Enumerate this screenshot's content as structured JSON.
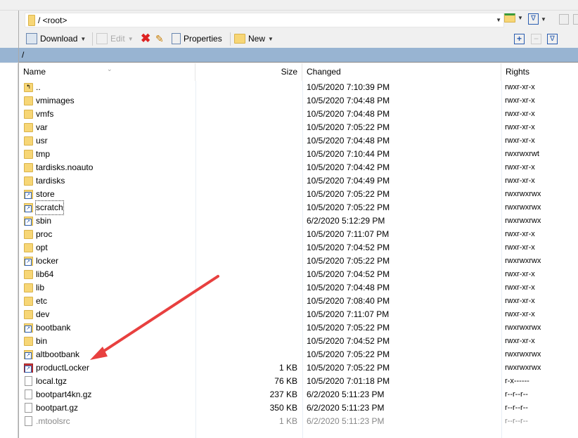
{
  "address_bar": {
    "path": "/ <root>"
  },
  "toolbar": {
    "download_label": "Download",
    "edit_label": "Edit",
    "properties_label": "Properties",
    "new_label": "New"
  },
  "path_bar": {
    "path": "/"
  },
  "columns": {
    "name": "Name",
    "size": "Size",
    "changed": "Changed",
    "rights": "Rights"
  },
  "files": [
    {
      "name": "..",
      "size": "",
      "changed": "10/5/2020 7:10:39 PM",
      "rights": "rwxr-xr-x",
      "type": "parent"
    },
    {
      "name": "vmimages",
      "size": "",
      "changed": "10/5/2020 7:04:48 PM",
      "rights": "rwxr-xr-x",
      "type": "folder"
    },
    {
      "name": "vmfs",
      "size": "",
      "changed": "10/5/2020 7:04:48 PM",
      "rights": "rwxr-xr-x",
      "type": "folder"
    },
    {
      "name": "var",
      "size": "",
      "changed": "10/5/2020 7:05:22 PM",
      "rights": "rwxr-xr-x",
      "type": "folder"
    },
    {
      "name": "usr",
      "size": "",
      "changed": "10/5/2020 7:04:48 PM",
      "rights": "rwxr-xr-x",
      "type": "folder"
    },
    {
      "name": "tmp",
      "size": "",
      "changed": "10/5/2020 7:10:44 PM",
      "rights": "rwxrwxrwt",
      "type": "folder"
    },
    {
      "name": "tardisks.noauto",
      "size": "",
      "changed": "10/5/2020 7:04:42 PM",
      "rights": "rwxr-xr-x",
      "type": "folder"
    },
    {
      "name": "tardisks",
      "size": "",
      "changed": "10/5/2020 7:04:49 PM",
      "rights": "rwxr-xr-x",
      "type": "folder"
    },
    {
      "name": "store",
      "size": "",
      "changed": "10/5/2020 7:05:22 PM",
      "rights": "rwxrwxrwx",
      "type": "link"
    },
    {
      "name": "scratch",
      "size": "",
      "changed": "10/5/2020 7:05:22 PM",
      "rights": "rwxrwxrwx",
      "type": "link",
      "focused": true
    },
    {
      "name": "sbin",
      "size": "",
      "changed": "6/2/2020 5:12:29 PM",
      "rights": "rwxrwxrwx",
      "type": "link"
    },
    {
      "name": "proc",
      "size": "",
      "changed": "10/5/2020 7:11:07 PM",
      "rights": "rwxr-xr-x",
      "type": "folder"
    },
    {
      "name": "opt",
      "size": "",
      "changed": "10/5/2020 7:04:52 PM",
      "rights": "rwxr-xr-x",
      "type": "folder"
    },
    {
      "name": "locker",
      "size": "",
      "changed": "10/5/2020 7:05:22 PM",
      "rights": "rwxrwxrwx",
      "type": "link"
    },
    {
      "name": "lib64",
      "size": "",
      "changed": "10/5/2020 7:04:52 PM",
      "rights": "rwxr-xr-x",
      "type": "folder"
    },
    {
      "name": "lib",
      "size": "",
      "changed": "10/5/2020 7:04:48 PM",
      "rights": "rwxr-xr-x",
      "type": "folder"
    },
    {
      "name": "etc",
      "size": "",
      "changed": "10/5/2020 7:08:40 PM",
      "rights": "rwxr-xr-x",
      "type": "folder"
    },
    {
      "name": "dev",
      "size": "",
      "changed": "10/5/2020 7:11:07 PM",
      "rights": "rwxr-xr-x",
      "type": "folder"
    },
    {
      "name": "bootbank",
      "size": "",
      "changed": "10/5/2020 7:05:22 PM",
      "rights": "rwxrwxrwx",
      "type": "link"
    },
    {
      "name": "bin",
      "size": "",
      "changed": "10/5/2020 7:04:52 PM",
      "rights": "rwxr-xr-x",
      "type": "folder"
    },
    {
      "name": "altbootbank",
      "size": "",
      "changed": "10/5/2020 7:05:22 PM",
      "rights": "rwxrwxrwx",
      "type": "link"
    },
    {
      "name": "productLocker",
      "size": "1 KB",
      "changed": "10/5/2020 7:05:22 PM",
      "rights": "rwxrwxrwx",
      "type": "brokenlink"
    },
    {
      "name": "local.tgz",
      "size": "76 KB",
      "changed": "10/5/2020 7:01:18 PM",
      "rights": "r-x------",
      "type": "file"
    },
    {
      "name": "bootpart4kn.gz",
      "size": "237 KB",
      "changed": "6/2/2020 5:11:23 PM",
      "rights": "r--r--r--",
      "type": "file"
    },
    {
      "name": "bootpart.gz",
      "size": "350 KB",
      "changed": "6/2/2020 5:11:23 PM",
      "rights": "r--r--r--",
      "type": "file"
    },
    {
      "name": ".mtoolsrc",
      "size": "1 KB",
      "changed": "6/2/2020 5:11:23 PM",
      "rights": "r--r--r--",
      "type": "file",
      "hidden": true
    }
  ],
  "colors": {
    "path_bar": "#98b4d2",
    "annotation_arrow": "#e8403f"
  }
}
